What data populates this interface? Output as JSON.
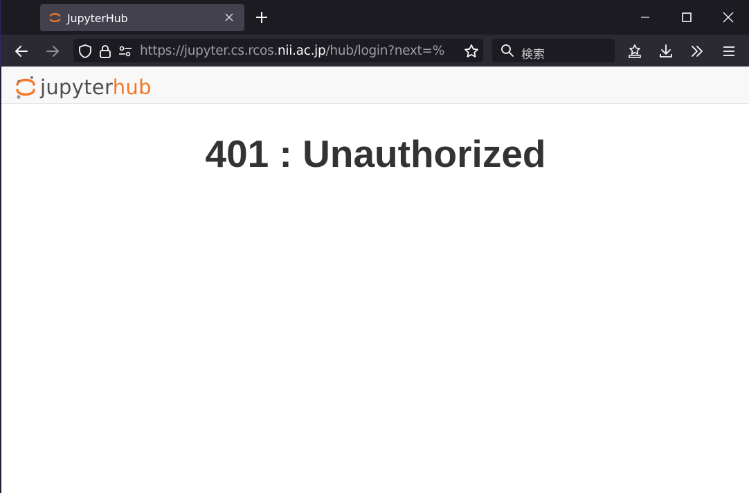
{
  "browser": {
    "tab": {
      "title": "JupyterHub",
      "favicon": "jupyter-logo-icon"
    },
    "url": {
      "prefix": "https://jupyter.cs.rcos.",
      "host": "nii.ac.jp",
      "path": "/hub/login?next=%"
    },
    "search": {
      "placeholder": "検索"
    },
    "icons": [
      "back-arrow-icon",
      "forward-arrow-icon",
      "shield-icon",
      "lock-icon",
      "permissions-icon",
      "star-icon",
      "search-icon",
      "pocket-icon",
      "download-icon",
      "overflow-chevrons-icon",
      "hamburger-menu-icon"
    ]
  },
  "page": {
    "logo": {
      "jupyter": "jupyter",
      "hub": "hub"
    },
    "error_title": "401 : Unauthorized"
  },
  "colors": {
    "accent": "#f37726",
    "titlebar": "#1c1b22",
    "toolbar": "#2b2a33",
    "tab": "#42414d"
  }
}
